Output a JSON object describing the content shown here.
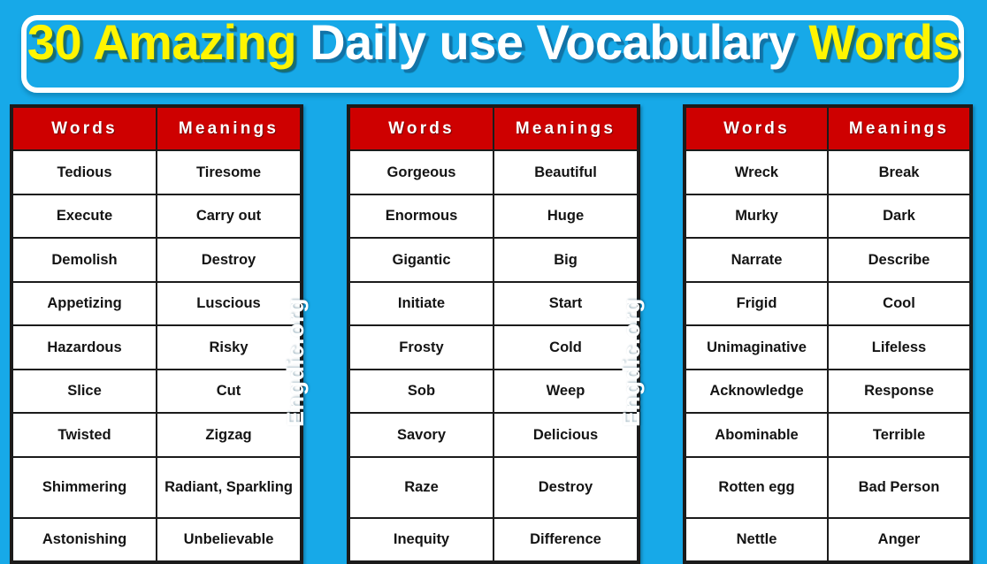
{
  "title": {
    "part1": "30 Amazing",
    "part2": "Daily use Vocabulary",
    "part3": "Words",
    "colors": {
      "yellow": "#FFF500",
      "white": "#FFFFFF",
      "background": "#17A9E8"
    }
  },
  "watermarks": [
    {
      "text": "Engdic.org"
    },
    {
      "text": "Engdic.org"
    }
  ],
  "theme": {
    "page_background": "#17A9E8",
    "header_red": "#CE0000",
    "cell_background": "#FFFFFF",
    "border": "#1B1B1B"
  },
  "tables": [
    {
      "headers": {
        "words": "Words",
        "meanings": "Meanings"
      },
      "rows": [
        {
          "word": "Tedious",
          "meaning": "Tiresome"
        },
        {
          "word": "Execute",
          "meaning": "Carry out"
        },
        {
          "word": "Demolish",
          "meaning": "Destroy"
        },
        {
          "word": "Appetizing",
          "meaning": "Luscious"
        },
        {
          "word": "Hazardous",
          "meaning": "Risky"
        },
        {
          "word": "Slice",
          "meaning": "Cut"
        },
        {
          "word": "Twisted",
          "meaning": "Zigzag"
        },
        {
          "word": "Shimmering",
          "meaning": "Radiant, Sparkling",
          "tall": true
        },
        {
          "word": "Astonishing",
          "meaning": "Unbelievable"
        }
      ]
    },
    {
      "headers": {
        "words": "Words",
        "meanings": "Meanings"
      },
      "rows": [
        {
          "word": "Gorgeous",
          "meaning": "Beautiful"
        },
        {
          "word": "Enormous",
          "meaning": "Huge"
        },
        {
          "word": "Gigantic",
          "meaning": "Big"
        },
        {
          "word": "Initiate",
          "meaning": "Start"
        },
        {
          "word": "Frosty",
          "meaning": "Cold"
        },
        {
          "word": "Sob",
          "meaning": "Weep"
        },
        {
          "word": "Savory",
          "meaning": "Delicious"
        },
        {
          "word": "Raze",
          "meaning": "Destroy",
          "tall": true
        },
        {
          "word": "Inequity",
          "meaning": "Difference"
        }
      ]
    },
    {
      "headers": {
        "words": "Words",
        "meanings": "Meanings"
      },
      "rows": [
        {
          "word": "Wreck",
          "meaning": "Break"
        },
        {
          "word": "Murky",
          "meaning": "Dark"
        },
        {
          "word": "Narrate",
          "meaning": "Describe"
        },
        {
          "word": "Frigid",
          "meaning": "Cool"
        },
        {
          "word": "Unimaginative",
          "meaning": "Lifeless"
        },
        {
          "word": "Acknowledge",
          "meaning": "Response"
        },
        {
          "word": "Abominable",
          "meaning": "Terrible"
        },
        {
          "word": "Rotten egg",
          "meaning": "Bad Person",
          "tall": true
        },
        {
          "word": "Nettle",
          "meaning": "Anger"
        }
      ]
    }
  ]
}
